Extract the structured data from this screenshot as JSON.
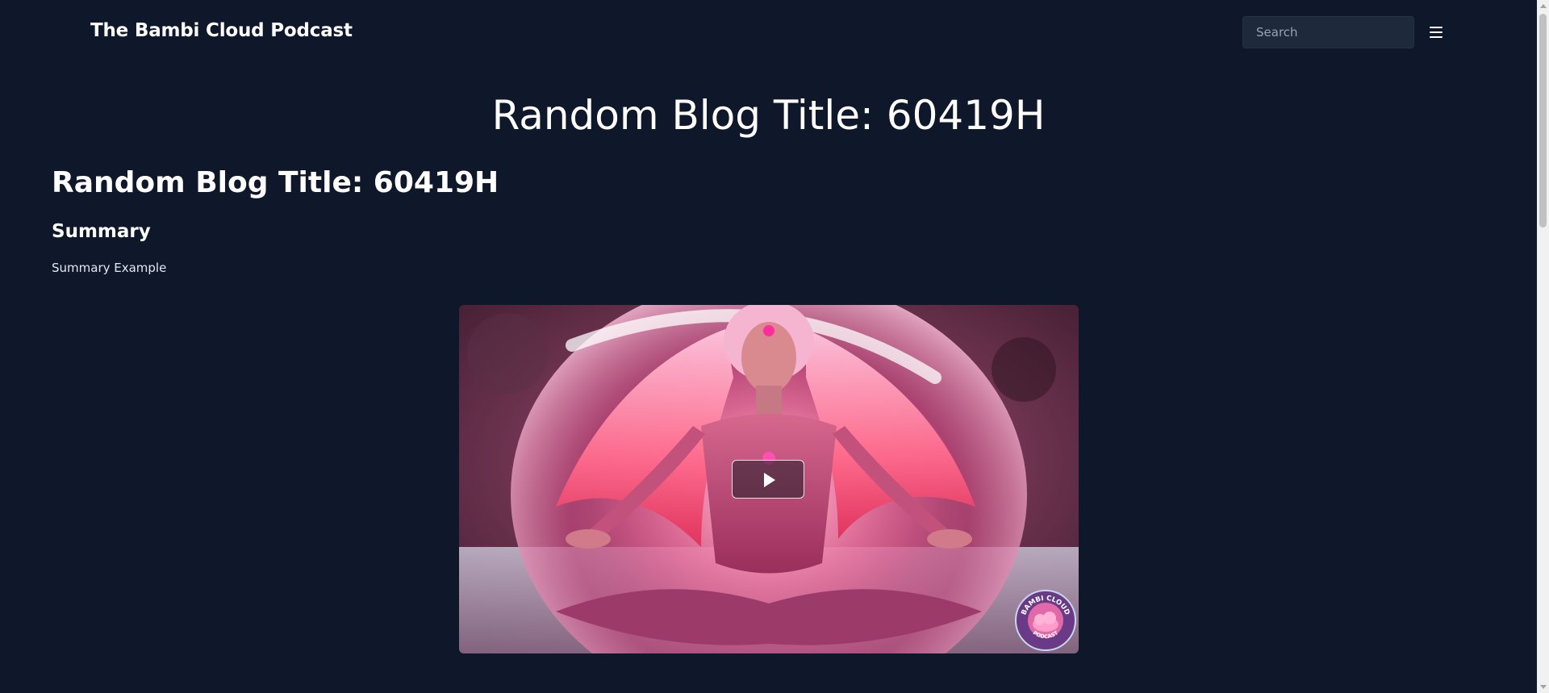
{
  "header": {
    "site_name": "The Bambi Cloud Podcast",
    "search": {
      "placeholder": "Search",
      "value": ""
    },
    "menu_icon": "hamburger-menu-icon"
  },
  "hero": {
    "title": "Random Blog Title: 60419H"
  },
  "post": {
    "title": "Random Blog Title: 60419H",
    "summary_heading": "Summary",
    "summary_text": "Summary Example"
  },
  "video": {
    "thumbnail": "pink-haired figure meditating inside a glowing bubble",
    "play_icon": "play-icon",
    "badge": {
      "top_text": "BAMBI CLOUD",
      "bottom_text": "PODCAST"
    }
  },
  "colors": {
    "background": "#0f172a",
    "search_background": "#1e293b",
    "text": "#ffffff"
  }
}
